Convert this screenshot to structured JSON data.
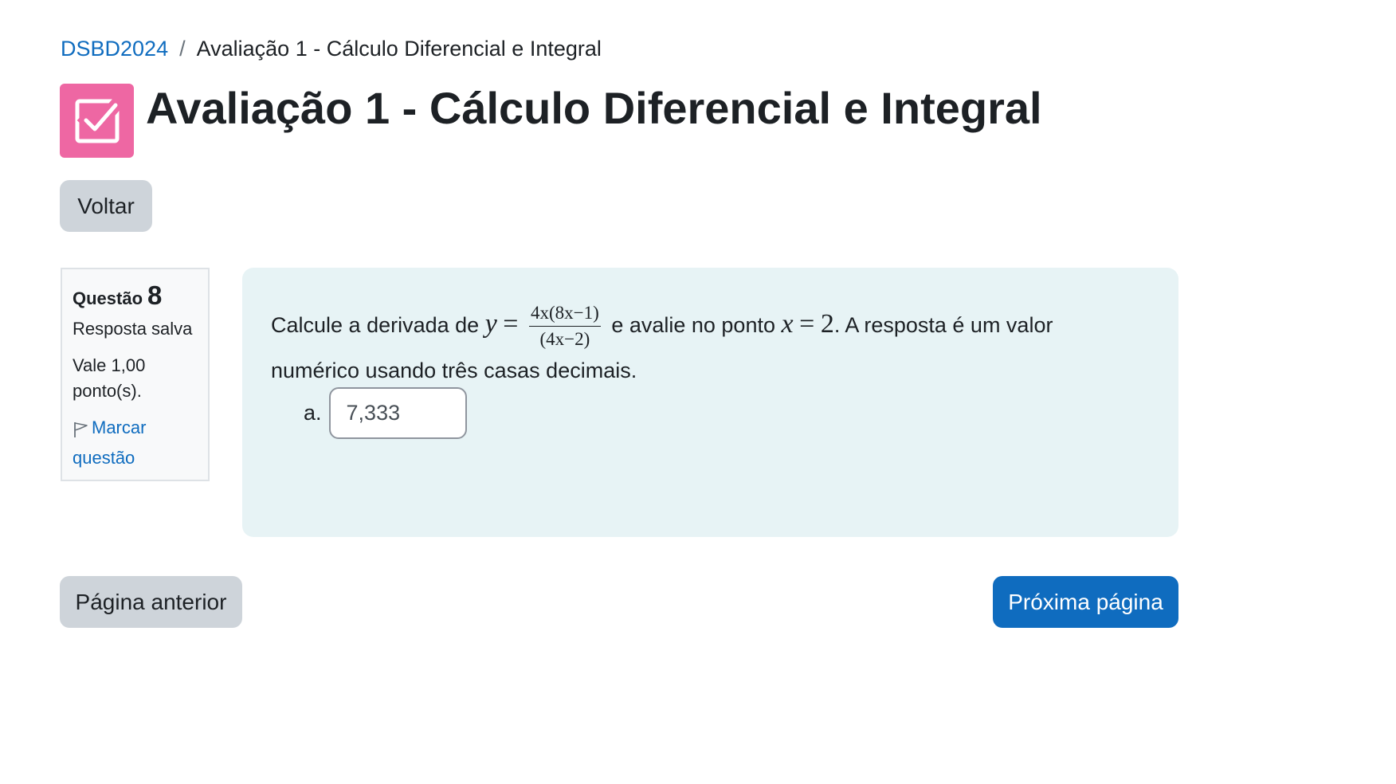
{
  "breadcrumb": {
    "course": "DSBD2024",
    "separator": "/",
    "current": "Avaliação 1 - Cálculo Diferencial e Integral"
  },
  "header": {
    "title": "Avaliação 1 - Cálculo Diferencial e Integral",
    "icon": "quiz-checkbox-icon",
    "icon_color": "#ee67a3"
  },
  "actions": {
    "back_label": "Voltar"
  },
  "question_info": {
    "label": "Questão",
    "number": "8",
    "state": "Resposta salva",
    "grade": "Vale 1,00 ponto(s).",
    "flag_label": "Marcar questão"
  },
  "question": {
    "text_before": "Calcule a derivada de",
    "formula": {
      "lhs": "y",
      "eq": "=",
      "numerator": "4x(8x−1)",
      "denominator": "(4x−2)"
    },
    "text_middle": "e avalie no ponto",
    "point": {
      "var": "x",
      "eq": "=",
      "value": "2"
    },
    "text_after_first_line": ". A resposta é um valor",
    "text_second_line": "numérico usando três casas decimais.",
    "answer_label": "a.",
    "answer_value": "7,333"
  },
  "navigation": {
    "prev_label": "Página anterior",
    "next_label": "Próxima página"
  },
  "colors": {
    "primary": "#0f6cbf",
    "secondary": "#ced4da",
    "content_bg": "#e7f3f5"
  }
}
